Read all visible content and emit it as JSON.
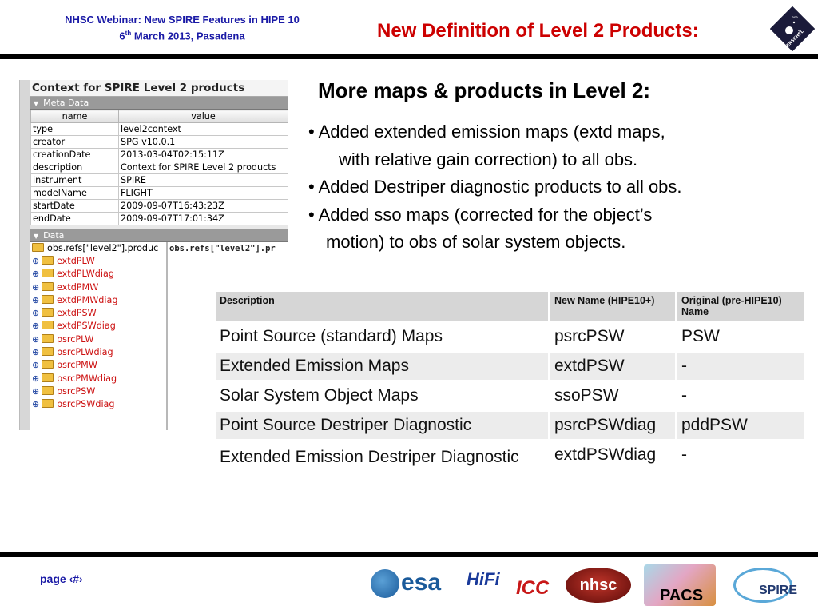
{
  "header": {
    "left_line1": "NHSC Webinar: New SPIRE Features in HIPE 10",
    "left_line2_num": "6",
    "left_line2_sup": "th",
    "left_line2_rest": " March 2013, Pasadena",
    "title": "New Definition of Level 2 Products:",
    "logo_icon": "herschel-logo-icon",
    "logo_text": "HERSCHEL",
    "logo_small_text": "esa"
  },
  "context_panel": {
    "title": "Context for SPIRE Level 2 products",
    "meta_section": "Meta Data",
    "columns": [
      "name",
      "value"
    ],
    "rows": [
      {
        "name": "type",
        "value": "level2context"
      },
      {
        "name": "creator",
        "value": "SPG v10.0.1"
      },
      {
        "name": "creationDate",
        "value": "2013-03-04T02:15:11Z"
      },
      {
        "name": "description",
        "value": "Context for SPIRE Level 2 products"
      },
      {
        "name": "instrument",
        "value": "SPIRE"
      },
      {
        "name": "modelName",
        "value": "FLIGHT"
      },
      {
        "name": "startDate",
        "value": "2009-09-07T16:43:23Z"
      },
      {
        "name": "endDate",
        "value": "2009-09-07T17:01:34Z"
      }
    ],
    "data_section": "Data",
    "tree_root": "obs.refs[\"level2\"].produc",
    "path_text": "obs.refs[\"level2\"].pr",
    "tree_items": [
      "extdPLW",
      "extdPLWdiag",
      "extdPMW",
      "extdPMWdiag",
      "extdPSW",
      "extdPSWdiag",
      "psrcPLW",
      "psrcPLWdiag",
      "psrcPMW",
      "psrcPMWdiag",
      "psrcPSW",
      "psrcPSWdiag"
    ]
  },
  "main": {
    "subhead": "More maps & products in Level 2:",
    "bullets": [
      {
        "line1": "• Added extended emission maps (extd maps,",
        "line2": "with relative gain correction) to all obs."
      },
      {
        "line1": "• Added Destriper diagnostic products to all obs.",
        "line2": ""
      },
      {
        "line1": "• Added sso maps (corrected for the object’s",
        "line2": "motion) to obs of solar system objects."
      }
    ]
  },
  "table": {
    "headers": {
      "description": "Description",
      "new_name": "New Name (HIPE10+)",
      "original": "Original (pre-HIPE10) Name"
    },
    "rows": [
      {
        "description": "Point Source (standard) Maps",
        "new_name": "psrcPSW",
        "original": "PSW"
      },
      {
        "description": "Extended Emission Maps",
        "new_name": "extdPSW",
        "original": "-"
      },
      {
        "description": "Solar System Object Maps",
        "new_name": "ssoPSW",
        "original": "-"
      },
      {
        "description": "Point Source Destriper Diagnostic",
        "new_name": "psrcPSWdiag",
        "original": "pddPSW"
      },
      {
        "description": "Extended Emission Destriper Diagnostic",
        "new_name": "extdPSWdiag",
        "original": "-"
      }
    ]
  },
  "footer": {
    "page_label": "page ‹#›",
    "logos": {
      "esa": "esa",
      "hifi": "HiFi",
      "icc": "ICC",
      "nhsc": "nhsc",
      "pacs": "PACS",
      "spire": "SPIRE"
    }
  },
  "colors": {
    "header_blue": "#1a1aa6",
    "title_red": "#cc0000",
    "tree_red": "#cc1010",
    "table_header_bg": "#d6d6d6",
    "table_row_shade": "#ececec"
  }
}
